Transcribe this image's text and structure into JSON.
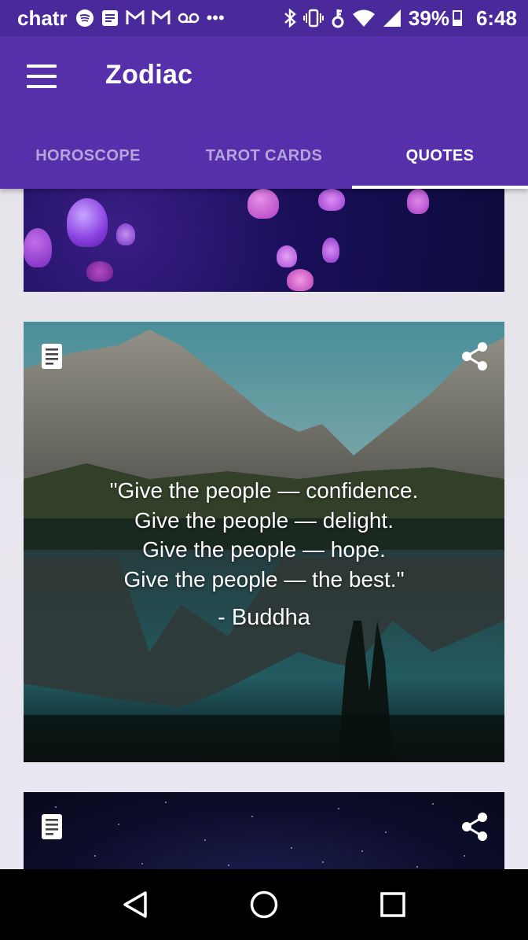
{
  "status_bar": {
    "carrier": "chatr",
    "icons": [
      "spotify-icon",
      "message-icon",
      "gmail-icon",
      "gmail-icon",
      "voicemail-icon",
      "more-icon",
      "bluetooth-icon",
      "vibrate-icon",
      "key-icon",
      "wifi-icon",
      "signal-icon"
    ],
    "more": "•••",
    "battery_percent": "39%",
    "time": "6:48"
  },
  "app_bar": {
    "title": "Zodiac",
    "menu_icon": "hamburger-menu-icon"
  },
  "tabs": [
    {
      "label": "HOROSCOPE",
      "active": false
    },
    {
      "label": "TAROT CARDS",
      "active": false
    },
    {
      "label": "QUOTES",
      "active": true
    }
  ],
  "cards": [
    {
      "image": "jellyfish"
    },
    {
      "image": "mountain-lake",
      "quote": "\"Give the people — confidence.\nGive the people — delight.\nGive the people — hope.\nGive the people — the best.\"",
      "author": "- Buddha",
      "left_icon": "document-icon",
      "right_icon": "share-icon"
    },
    {
      "image": "starry-night",
      "left_icon": "document-icon",
      "right_icon": "share-icon"
    }
  ],
  "nav_bar": {
    "back": "back-icon",
    "home": "home-icon",
    "recents": "recents-icon"
  },
  "colors": {
    "status_bar": "#4a2a9a",
    "app_bar": "#5530aa",
    "tab_inactive": "#b6a4dc",
    "tab_active": "#ffffff"
  }
}
